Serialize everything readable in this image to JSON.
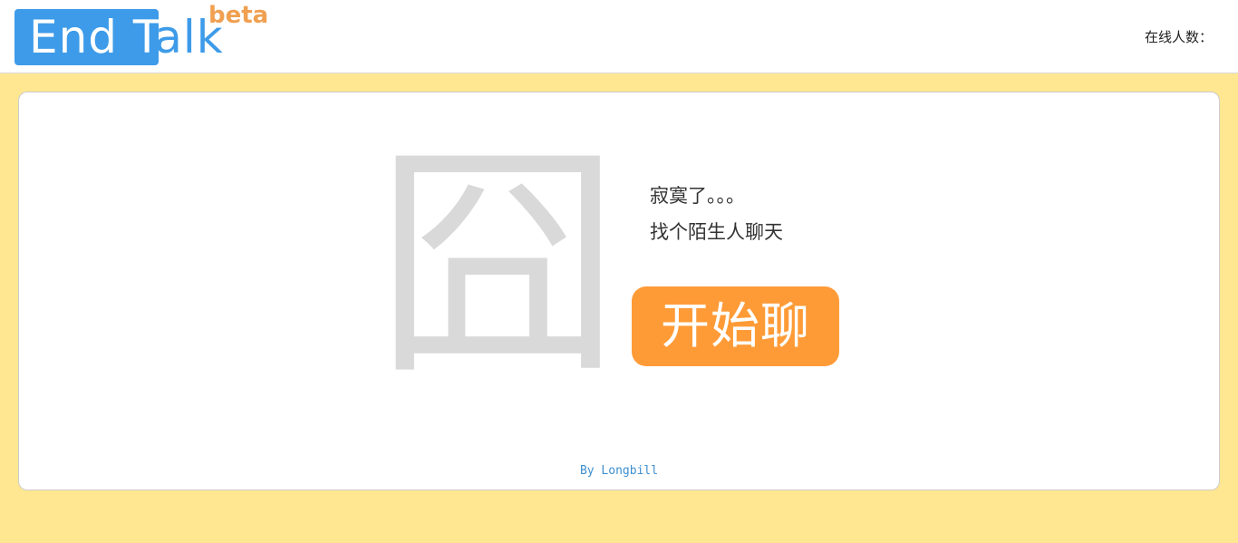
{
  "header": {
    "logo": {
      "text_boxed": "End T",
      "text_plain": "alk",
      "badge": "beta"
    },
    "online_label": "在线人数："
  },
  "main": {
    "big_char": "囧",
    "tagline": [
      "寂寞了。。。",
      "找个陌生人聊天"
    ],
    "start_button_label": "开始聊",
    "footer": "By Longbill"
  },
  "colors": {
    "background": "#ffe791",
    "brand_blue": "#3d9be9",
    "button_orange": "#ff9b37",
    "beta_orange": "#f0a050"
  }
}
